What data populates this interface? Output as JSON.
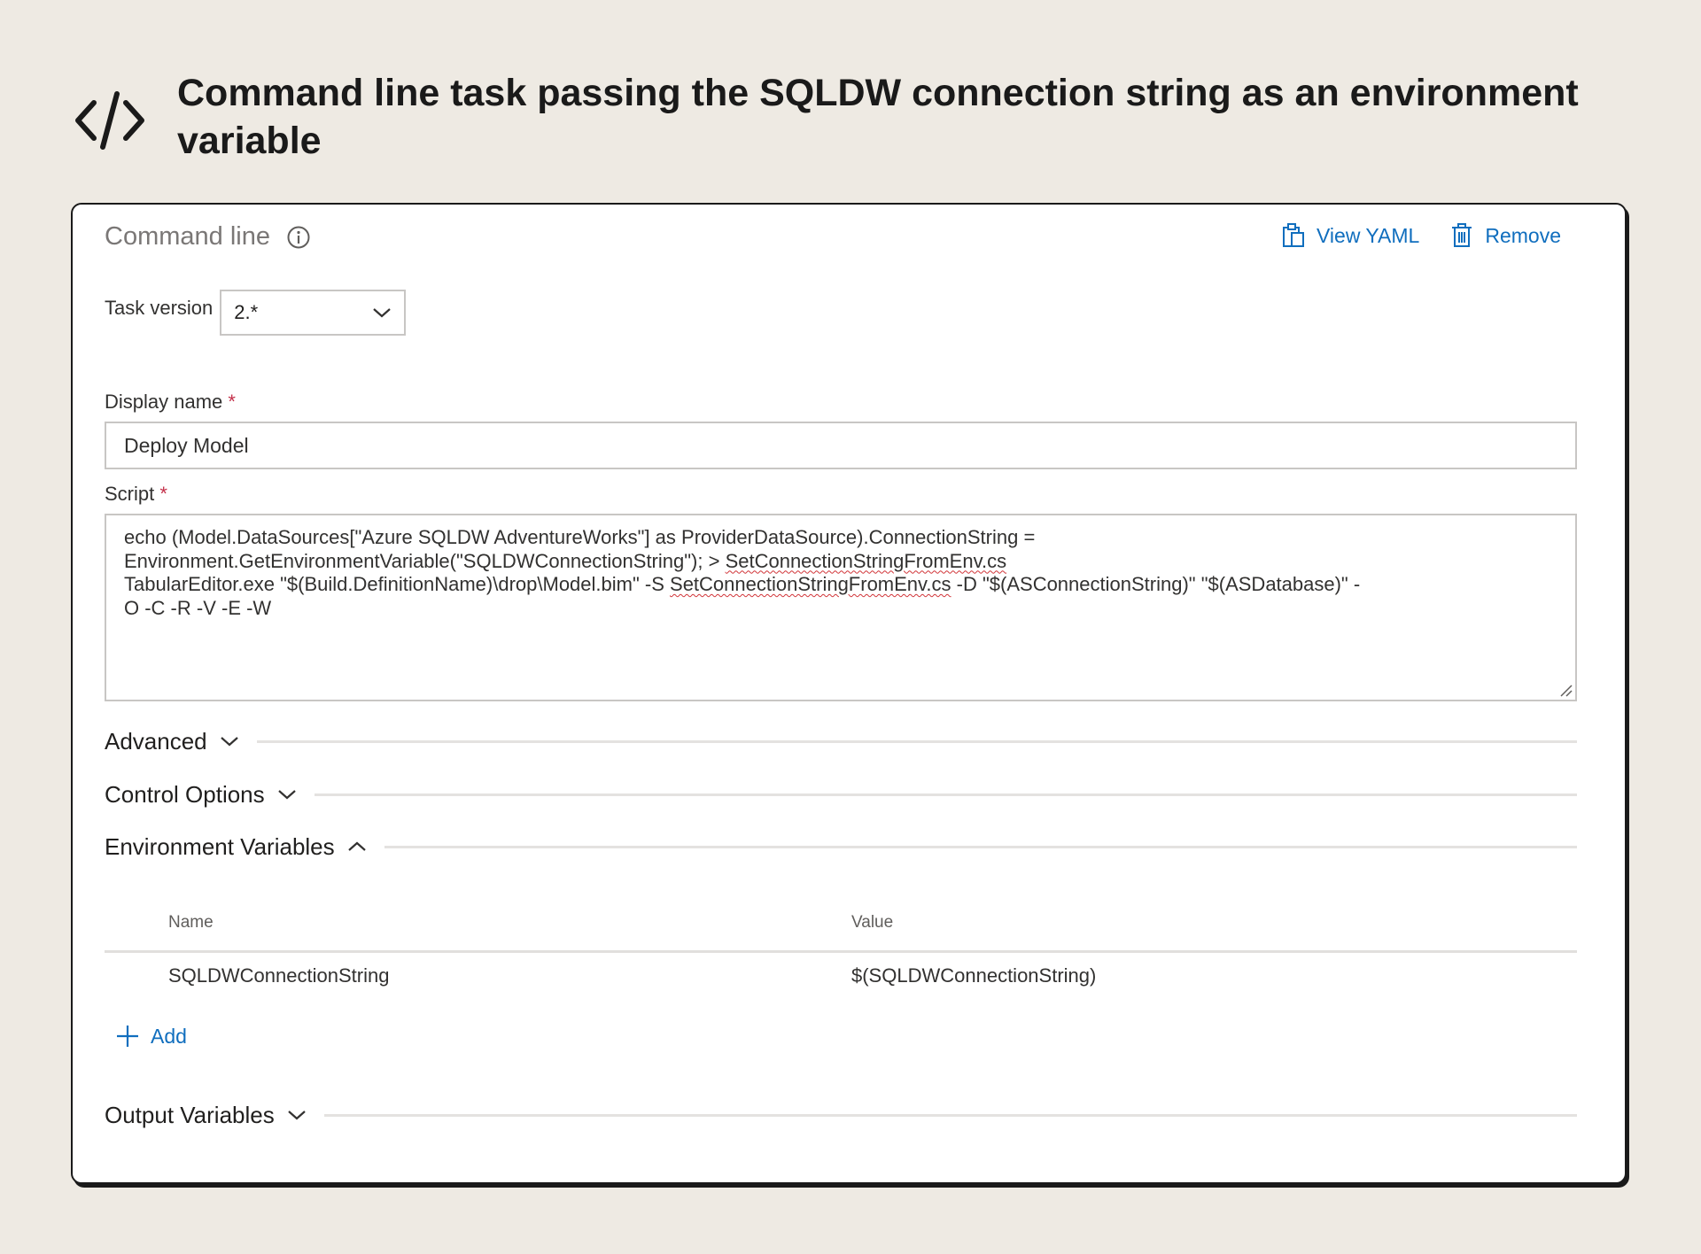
{
  "header": {
    "title": "Command line task passing the SQLDW connection string as an environment variable",
    "icon": "code-icon"
  },
  "task": {
    "title": "Command line",
    "actions": {
      "view_yaml": "View YAML",
      "remove": "Remove"
    },
    "task_version": {
      "label": "Task version",
      "value": "2.*"
    },
    "display_name": {
      "label": "Display name",
      "required_mark": "*",
      "value": "Deploy Model"
    },
    "script": {
      "label": "Script",
      "required_mark": "*",
      "line1": "echo (Model.DataSources[\"Azure SQLDW AdventureWorks\"] as ProviderDataSource).ConnectionString =",
      "line2_a": "Environment.GetEnvironmentVariable(\"SQLDWConnectionString\"); > ",
      "line2_b": "SetConnectionStringFromEnv.cs",
      "line3_a": "TabularEditor.exe \"$(Build.DefinitionName)\\drop\\Model.bim\" -S ",
      "line3_b": "SetConnectionStringFromEnv.cs",
      "line3_c": " -D \"$(ASConnectionString)\" \"$(ASDatabase)\" -",
      "line4": "O -C -R -V -E -W"
    },
    "sections": {
      "advanced": "Advanced",
      "control_options": "Control Options",
      "environment_variables": "Environment Variables",
      "output_variables": "Output Variables"
    },
    "env_table": {
      "columns": {
        "name": "Name",
        "value": "Value"
      },
      "rows": [
        {
          "name": "SQLDWConnectionString",
          "value": "$(SQLDWConnectionString)"
        }
      ]
    },
    "add_label": "Add"
  },
  "colors": {
    "accent": "#106ebe",
    "required": "#c4314b",
    "background": "#eeeae3"
  }
}
